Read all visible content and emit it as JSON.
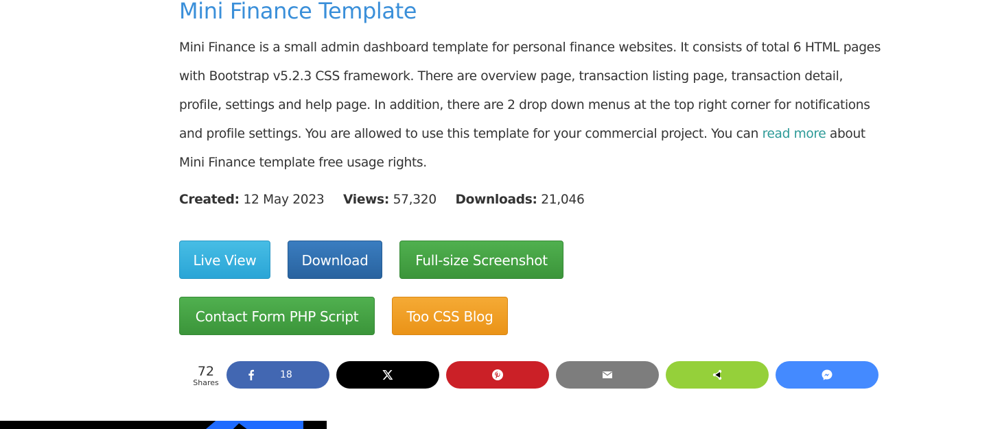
{
  "title": "Mini Finance Template",
  "description": {
    "text_before_link": "Mini Finance is a small admin dashboard template for personal finance websites. It consists of total 6 HTML pages with Bootstrap v5.2.3 CSS framework. There are overview page, transaction listing page, transaction detail, profile, settings and help page. In addition, there are 2 drop down menus at the top right corner for notifications and profile settings. You are allowed to use this template for your commercial project. You can ",
    "link_text": "read more",
    "text_after_link": " about Mini Finance template free usage rights."
  },
  "meta": {
    "created_label": "Created:",
    "created_value": "12 May 2023",
    "views_label": "Views:",
    "views_value": "57,320",
    "downloads_label": "Downloads:",
    "downloads_value": "21,046"
  },
  "buttons": {
    "live_view": "Live View",
    "download": "Download",
    "full_screenshot": "Full-size Screenshot",
    "contact_form": "Contact Form PHP Script",
    "blog": "Too CSS Blog"
  },
  "share": {
    "total": "72",
    "total_label": "Shares",
    "facebook_count": "18",
    "icons": [
      "facebook-icon",
      "x-icon",
      "pinterest-icon",
      "email-icon",
      "share-icon",
      "messenger-icon"
    ]
  },
  "colors": {
    "title": "#3a8fd9",
    "link": "#2c9a97",
    "live_view": "#2aa5d6",
    "download": "#29639f",
    "green": "#3b953a",
    "orange": "#ea9317",
    "facebook": "#4267b2",
    "x": "#000000",
    "pinterest": "#cb2027",
    "email": "#7d7d7d",
    "sharethis": "#95d03a",
    "messenger": "#448aff"
  }
}
